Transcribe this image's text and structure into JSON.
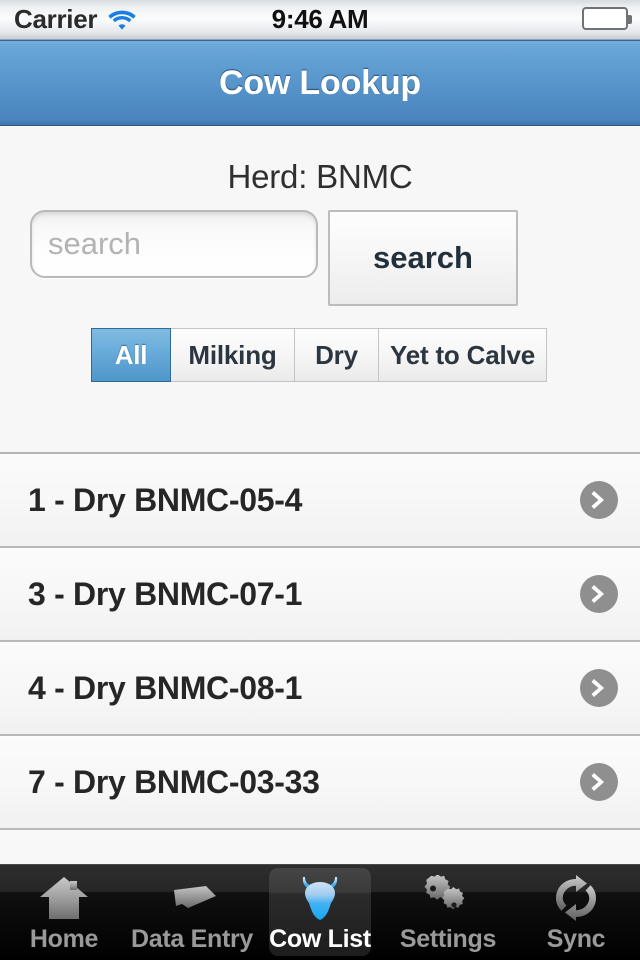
{
  "status_bar": {
    "carrier": "Carrier",
    "wifi_icon": "wifi-icon",
    "time": "9:46 AM",
    "battery_icon": "battery-full-icon"
  },
  "nav_bar": {
    "title": "Cow Lookup"
  },
  "header": {
    "herd_label": "Herd: BNMC",
    "search_placeholder": "search",
    "search_value": "",
    "search_button_label": "search"
  },
  "filters": {
    "segments": [
      {
        "label": "All",
        "selected": true
      },
      {
        "label": "Milking",
        "selected": false
      },
      {
        "label": "Dry",
        "selected": false
      },
      {
        "label": "Yet to Calve",
        "selected": false
      }
    ]
  },
  "cow_list": {
    "rows": [
      {
        "label": "1 - Dry BNMC-05-4",
        "disclosure_icon": "chevron-right-circle-icon"
      },
      {
        "label": "3 - Dry BNMC-07-1",
        "disclosure_icon": "chevron-right-circle-icon"
      },
      {
        "label": "4 - Dry BNMC-08-1",
        "disclosure_icon": "chevron-right-circle-icon"
      },
      {
        "label": "7 - Dry BNMC-03-33",
        "disclosure_icon": "chevron-right-circle-icon"
      }
    ]
  },
  "tab_bar": {
    "tabs": [
      {
        "label": "Home",
        "icon": "house-icon",
        "selected": false
      },
      {
        "label": "Data Entry",
        "icon": "data-entry-icon",
        "selected": false
      },
      {
        "label": "Cow List",
        "icon": "cow-head-icon",
        "selected": true
      },
      {
        "label": "Settings",
        "icon": "gears-icon",
        "selected": false
      },
      {
        "label": "Sync",
        "icon": "sync-arrows-icon",
        "selected": false
      }
    ]
  },
  "colors": {
    "nav_bar_top": "#75aede",
    "nav_bar_bottom": "#3f74ac",
    "segment_selected": "#4f96ca",
    "disclosure_gray": "#8f8f8f",
    "battery_green": "#63cf16",
    "wifi_blue": "#1a7fe0",
    "cow_icon_blue": "#2fa8f0",
    "tab_bar_black": "#000000"
  }
}
